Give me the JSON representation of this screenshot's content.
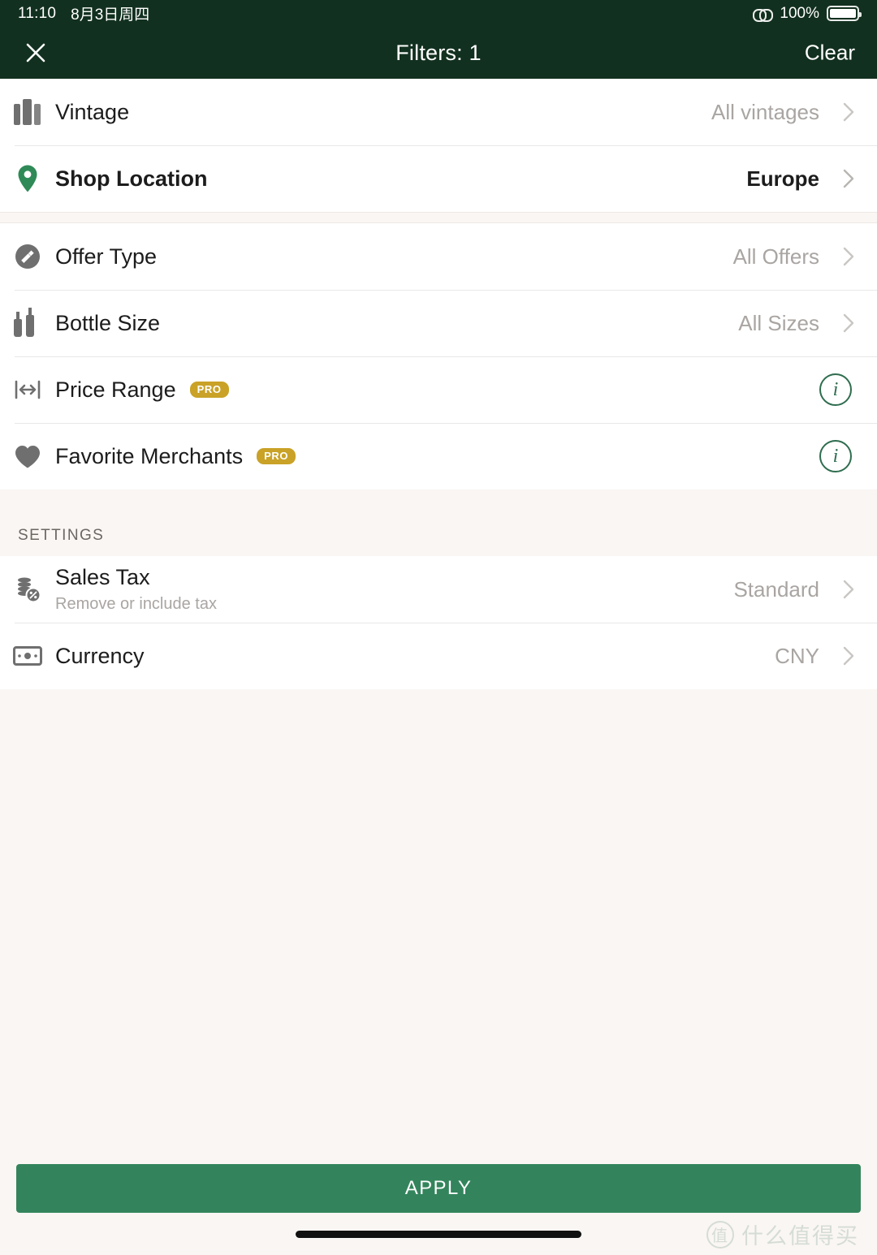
{
  "status_bar": {
    "time": "11:10",
    "date": "8月3日周四",
    "battery_percent": "100%",
    "link_icon": "link-icon",
    "battery_icon": "battery-icon"
  },
  "header": {
    "title": "Filters: 1",
    "close_icon": "close-icon",
    "clear_label": "Clear"
  },
  "filters": {
    "group_a": [
      {
        "id": "vintage",
        "label": "Vintage",
        "value": "All vintages",
        "icon": "books-icon",
        "active": false
      },
      {
        "id": "shop-location",
        "label": "Shop Location",
        "value": "Europe",
        "icon": "map-pin-icon",
        "active": true
      }
    ],
    "group_b": [
      {
        "id": "offer-type",
        "label": "Offer Type",
        "value": "All Offers",
        "icon": "gavel-icon",
        "active": false
      },
      {
        "id": "bottle-size",
        "label": "Bottle Size",
        "value": "All Sizes",
        "icon": "bottles-icon",
        "active": false
      },
      {
        "id": "price-range",
        "label": "Price Range",
        "badge": "PRO",
        "icon": "arrows-horizontal-icon",
        "info_icon": "info-icon",
        "active": false
      },
      {
        "id": "favorite-merchants",
        "label": "Favorite Merchants",
        "badge": "PRO",
        "icon": "heart-icon",
        "info_icon": "info-icon",
        "active": false
      }
    ]
  },
  "settings": {
    "section_label": "SETTINGS",
    "items": [
      {
        "id": "sales-tax",
        "label": "Sales Tax",
        "subtitle": "Remove or include tax",
        "value": "Standard",
        "icon": "coins-percent-icon"
      },
      {
        "id": "currency",
        "label": "Currency",
        "value": "CNY",
        "icon": "banknote-icon"
      }
    ]
  },
  "footer": {
    "apply_label": "APPLY"
  },
  "watermark": {
    "badge": "值",
    "text": "什么值得买"
  },
  "colors": {
    "header_green": "#12301f",
    "accent_green": "#2f6d4f",
    "apply_green": "#33845c",
    "pro_gold": "#c9a227",
    "page_bg": "#faf6f3",
    "muted_text": "#a9a5a2"
  }
}
